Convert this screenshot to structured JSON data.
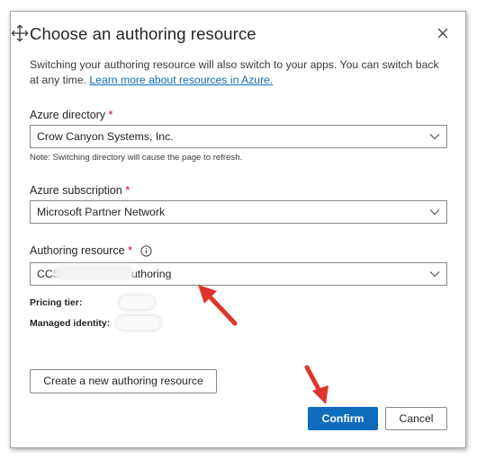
{
  "dialog": {
    "title": "Choose an authoring resource",
    "description": "Switching your authoring resource will also switch to your apps. You can switch back at any time.",
    "learn_more_link": "Learn more about resources in Azure."
  },
  "fields": {
    "directory": {
      "label": "Azure directory",
      "required_mark": "*",
      "value": "Crow Canyon Systems, Inc.",
      "note": "Note: Switching directory will cause the page to refresh."
    },
    "subscription": {
      "label": "Azure subscription",
      "required_mark": "*",
      "value": "Microsoft Partner Network"
    },
    "resource": {
      "label": "Authoring resource",
      "required_mark": "*",
      "value_prefix": "CCS",
      "value_suffix": "uthoring"
    },
    "pricing_tier": {
      "label": "Pricing tier:"
    },
    "managed_identity": {
      "label": "Managed identity:"
    }
  },
  "buttons": {
    "create_new": "Create a new authoring resource",
    "confirm": "Confirm",
    "cancel": "Cancel"
  },
  "colors": {
    "primary": "#0f6cbd",
    "required": "#c50f1f",
    "annotation_arrow": "#e0342a"
  },
  "icons": {
    "move": "move-icon",
    "close": "close-icon",
    "chevron": "chevron-down-icon",
    "info": "info-icon"
  }
}
